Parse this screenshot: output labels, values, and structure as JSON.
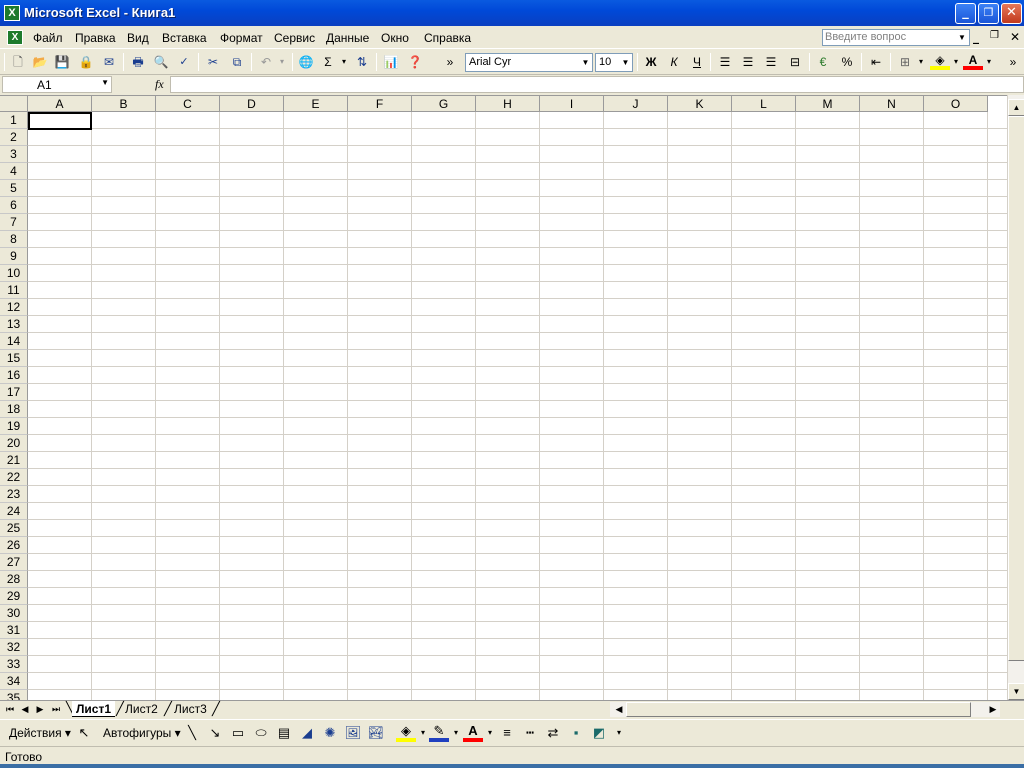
{
  "window": {
    "title": "Microsoft Excel - Книга1",
    "app_icon_glyph": "X",
    "minimize": "_",
    "restore": "❐",
    "close": "✕"
  },
  "menu": {
    "items": [
      "Файл",
      "Правка",
      "Вид",
      "Вставка",
      "Формат",
      "Сервис",
      "Данные",
      "Окно",
      "Справка"
    ],
    "help_placeholder": "Введите вопрос"
  },
  "toolbar": {
    "font_name": "Arial Cyr",
    "font_size": "10",
    "bold": "Ж",
    "italic": "К",
    "underline": "Ч",
    "sum": "Σ",
    "percent": "%",
    "overflow": "»"
  },
  "formula_bar": {
    "name_box": "A1",
    "fx_label": "fx",
    "formula": ""
  },
  "grid": {
    "columns": [
      "A",
      "B",
      "C",
      "D",
      "E",
      "F",
      "G",
      "H",
      "I",
      "J",
      "K",
      "L",
      "M",
      "N",
      "O"
    ],
    "rows": [
      "1",
      "2",
      "3",
      "4",
      "5",
      "6",
      "7",
      "8",
      "9",
      "10",
      "11",
      "12",
      "13",
      "14",
      "15",
      "16",
      "17",
      "18",
      "19",
      "20",
      "21",
      "22",
      "23",
      "24",
      "25",
      "26",
      "27",
      "28",
      "29",
      "30",
      "31",
      "32",
      "33",
      "34",
      "35"
    ],
    "active_cell": "A1"
  },
  "sheets": {
    "tabs": [
      "Лист1",
      "Лист2",
      "Лист3"
    ],
    "active": "Лист1"
  },
  "drawing": {
    "actions_label": "Действия",
    "autoshapes_label": "Автофигуры"
  },
  "status": {
    "text": "Готово"
  },
  "colors": {
    "titlebar": "#0a5ae0",
    "fill_highlight": "#ffff00",
    "font_color": "#ff0000"
  }
}
